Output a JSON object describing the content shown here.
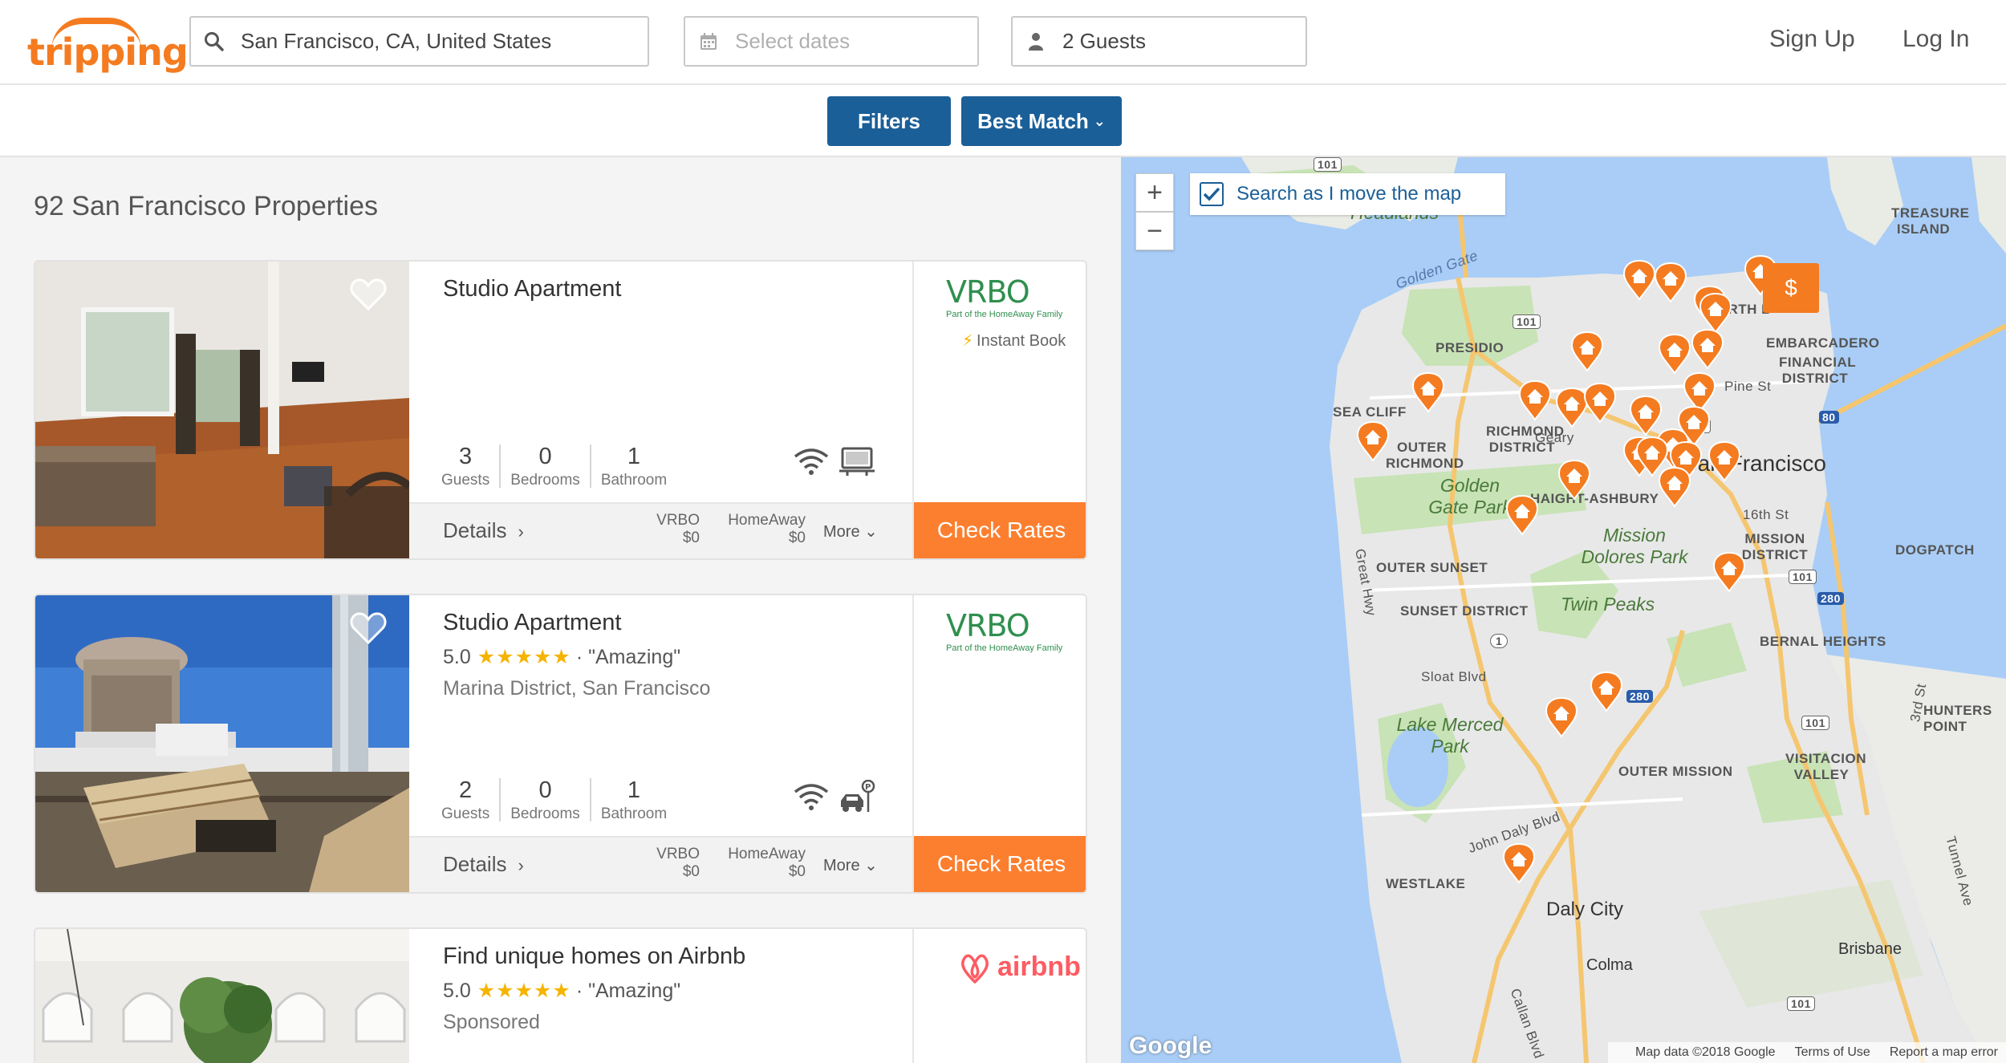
{
  "header": {
    "logo_text": "tripping",
    "location_value": "San Francisco, CA, United States",
    "dates_placeholder": "Select dates",
    "guests_value": "2 Guests",
    "signup_label": "Sign Up",
    "login_label": "Log In"
  },
  "toolbar": {
    "filters_label": "Filters",
    "sort_label": "Best Match"
  },
  "results": {
    "title": "92 San Francisco Properties",
    "listings": [
      {
        "title": "Studio Apartment",
        "rating": "",
        "review": "",
        "location": "",
        "guests": "3",
        "bedrooms": "0",
        "bathrooms": "1",
        "guests_label": "Guests",
        "bedrooms_label": "Bedrooms",
        "bathroom_label": "Bathroom",
        "amenities": [
          "wifi-icon",
          "tv-icon"
        ],
        "provider": "VRBO",
        "provider_sub": "Part of the HomeAway Family",
        "instant_book": "Instant Book",
        "details_label": "Details",
        "price_1_name": "VRBO",
        "price_1_value": "$0",
        "price_2_name": "HomeAway",
        "price_2_value": "$0",
        "more_label": "More",
        "cta": "Check Rates"
      },
      {
        "title": "Studio Apartment",
        "rating": "5.0",
        "review": "· \"Amazing\"",
        "location": "Marina District, San Francisco",
        "guests": "2",
        "bedrooms": "0",
        "bathrooms": "1",
        "guests_label": "Guests",
        "bedrooms_label": "Bedrooms",
        "bathroom_label": "Bathroom",
        "amenities": [
          "wifi-icon",
          "parking-icon"
        ],
        "provider": "VRBO",
        "provider_sub": "Part of the HomeAway Family",
        "details_label": "Details",
        "price_1_name": "VRBO",
        "price_1_value": "$0",
        "price_2_name": "HomeAway",
        "price_2_value": "$0",
        "more_label": "More",
        "cta": "Check Rates"
      },
      {
        "title": "Find unique homes on Airbnb",
        "rating": "5.0",
        "review": "· \"Amazing\"",
        "location": "Sponsored",
        "provider": "airbnb"
      }
    ],
    "stars": "★★★★★"
  },
  "map": {
    "search_as_move": "Search as I move the map",
    "zoom_in": "+",
    "zoom_out": "−",
    "price_pin": "$",
    "footer_data": "Map data ©2018 Google",
    "footer_terms": "Terms of Use",
    "footer_report": "Report a map error",
    "google": "Google",
    "labels": {
      "treasure_island": "TREASURE ISLAND",
      "headlands": "Headlands",
      "golden_gate": "Golden Gate",
      "presidio": "PRESIDIO",
      "north_beach": "NORTH B",
      "embarcadero": "EMBARCADERO",
      "financial": "FINANCIAL DISTRICT",
      "pine_st": "Pine St",
      "sea_cliff": "SEA CLIFF",
      "richmond": "RICHMOND DISTRICT",
      "outer_richmond": "OUTER RICHMOND",
      "geary": "Geary",
      "san_francisco": "San Francisco",
      "golden_gate_park": "Golden Gate Park",
      "haight": "HAIGHT-ASHBURY",
      "sixteenth": "16th St",
      "mission_dolores": "Mission Dolores Park",
      "mission_district": "MISSION DISTRICT",
      "dogpatch": "DOGPATCH",
      "outer_sunset": "OUTER SUNSET",
      "great_hwy": "Great Hwy",
      "sunset": "SUNSET DISTRICT",
      "twin_peaks": "Twin Peaks",
      "bernal": "BERNAL HEIGHTS",
      "sloat": "Sloat Blvd",
      "lake_merced": "Lake Merced Park",
      "hunters_point": "HUNTERS POINT",
      "outer_mission": "OUTER MISSION",
      "visitacion": "VISITACION VALLEY",
      "john_daly": "John Daly Blvd",
      "westlake": "WESTLAKE",
      "daly_city": "Daly City",
      "colma": "Colma",
      "brisbane": "Brisbane",
      "third_st": "3rd St",
      "tunnel": "Tunnel Ave",
      "callan": "Callan Blvd",
      "r101a": "101",
      "r101b": "101",
      "r101c": "101",
      "r101d": "101",
      "r101e": "101",
      "r101f": "101",
      "r1": "1",
      "r280a": "280",
      "r280b": "280",
      "r80": "80"
    }
  },
  "colors": {
    "brand_orange": "#f47b20",
    "cta_orange": "#fc7f2f",
    "primary_blue": "#1b5f98",
    "vrbo_green": "#2f8f4e",
    "airbnb_red": "#fd5c63"
  }
}
